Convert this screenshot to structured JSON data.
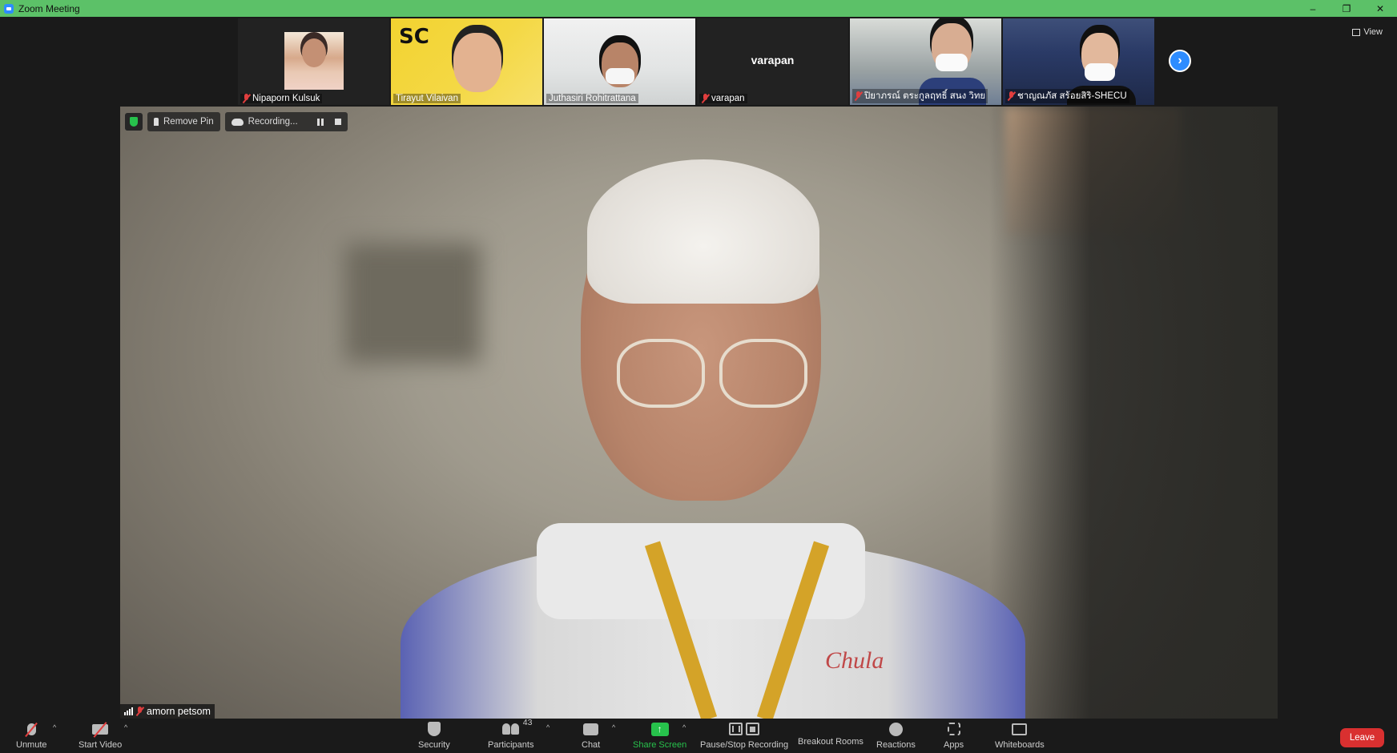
{
  "window": {
    "title": "Zoom Meeting",
    "minimize": "–",
    "restore": "❐",
    "close": "✕"
  },
  "view_button": {
    "label": "View"
  },
  "participants_strip": [
    {
      "name": "Nipaporn Kulsuk",
      "muted": true
    },
    {
      "name": "Tirayut Vilaivan",
      "muted": false,
      "bg_text": "SC"
    },
    {
      "name": "Juthasiri Rohitrattana",
      "muted": false
    },
    {
      "name": "varapan",
      "muted": true,
      "center_label": "varapan"
    },
    {
      "name": "ปิยาภรณ์ ตระกูลฤทธิ์ สนง วิทย",
      "muted": true
    },
    {
      "name": "ชาญณภัส สร้อยสิริ-SHECU",
      "muted": true
    }
  ],
  "next_page_icon": "›",
  "pinned": {
    "remove_pin": "Remove Pin",
    "recording": "Recording...",
    "speaker_name": "amorn petsom",
    "logo_text": "Chula"
  },
  "toolbar": {
    "unmute": "Unmute",
    "start_video": "Start Video",
    "security": "Security",
    "participants": "Participants",
    "participants_count": "43",
    "chat": "Chat",
    "share_screen": "Share Screen",
    "pause_stop_recording": "Pause/Stop Recording",
    "breakout_rooms": "Breakout Rooms",
    "reactions": "Reactions",
    "apps": "Apps",
    "whiteboards": "Whiteboards",
    "leave": "Leave",
    "caret": "^"
  },
  "colors": {
    "title_bar": "#5cc168",
    "accent_green": "#27c24c",
    "accent_blue": "#2d8cff",
    "leave_red": "#d93030"
  }
}
